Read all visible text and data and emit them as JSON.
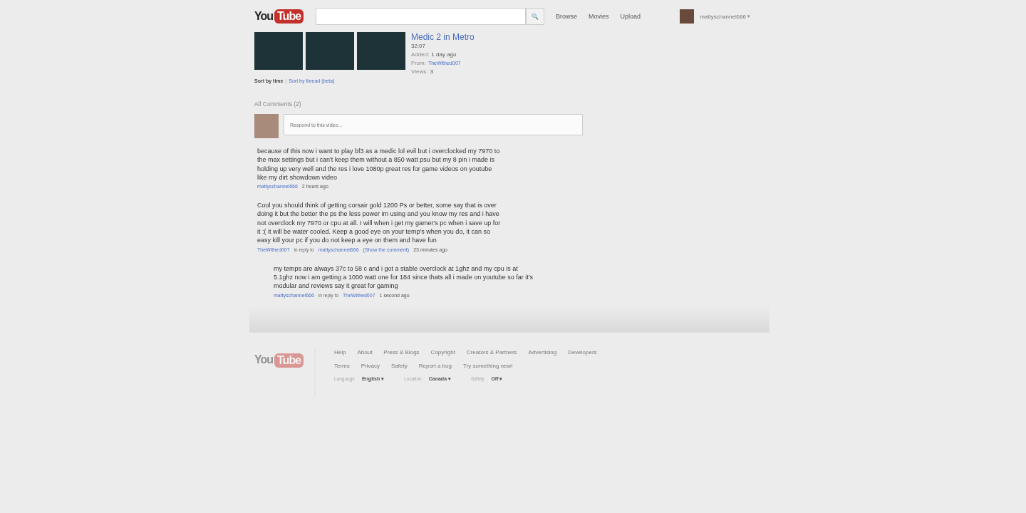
{
  "header": {
    "logo": {
      "you": "You",
      "tube": "Tube"
    },
    "search_button": "🔍",
    "nav": [
      "Browse",
      "Movies",
      "Upload"
    ],
    "username": "mattyschannel666",
    "caret": "▾"
  },
  "video": {
    "title": "Medic 2 in Metro",
    "duration": "32:07",
    "added_label": "Added:",
    "added": "1 day ago",
    "from_label": "From:",
    "from": "TheWithed007",
    "views_label": "Views:",
    "views": "3"
  },
  "sort": {
    "by_time": "Sort by time",
    "separator": "|",
    "by_thread": "Sort by thread (beta)"
  },
  "comments_heading": "All Comments (2)",
  "respond": {
    "placeholder": "Respond to this video..."
  },
  "comments": [
    {
      "kind": "top",
      "text": "because of this now i want to play bf3 as a medic lol evil but i overclocked my 7970 to the max settings but i can't keep them without a 850 watt psu but my 8 pin i made is holding up very well and the res i love 1080p great res for game videos on youtube like my dirt showdown video",
      "author": "mattyschannel666",
      "time": "2 hours ago"
    },
    {
      "kind": "reply",
      "text": "Cool you should think of getting corsair gold 1200 Ps or better, some say that is over doing it but the better the ps the less power im using and you know my res and i have not overclock my 7970 or cpu at all. I will when i get my gamer's pc when i save up for it :( it will be water cooled. Keep a good eye on your temp's when you do, it can so easy kill your pc if you do not keep a eye on them and have fun",
      "author": "TheWithed007",
      "in_reply_label": "in reply to",
      "reply_to": "mattyschannel666",
      "show_link": "(Show the comment)",
      "time": "23 minutes ago",
      "nested": false
    },
    {
      "kind": "reply",
      "text": "my temps are always 37c to 58 c and i got a stable overclock at 1ghz and my cpu is at 5.1ghz now i am getting a 1000 watt one for 184 since thats all i made on youtube so far it's modular and reviews say it great for gaming",
      "author": "mattyschannel666",
      "in_reply_label": "in reply to",
      "reply_to": "TheWithed007",
      "time": "1 second ago",
      "nested": true
    }
  ],
  "footer": {
    "logo": {
      "you": "You",
      "tube": "Tube"
    },
    "links_row_1": [
      "Help",
      "About",
      "Press & Blogs",
      "Copyright",
      "Creators & Partners",
      "Advertising",
      "Developers"
    ],
    "links_row_2": [
      "Terms",
      "Privacy",
      "Safety",
      "Report a bug",
      "Try something new!"
    ],
    "settings": [
      {
        "label": "Language",
        "value": "English"
      },
      {
        "label": "Location",
        "value": "Canada"
      },
      {
        "label": "Safety",
        "value": "Off"
      }
    ],
    "caret": "▾"
  }
}
